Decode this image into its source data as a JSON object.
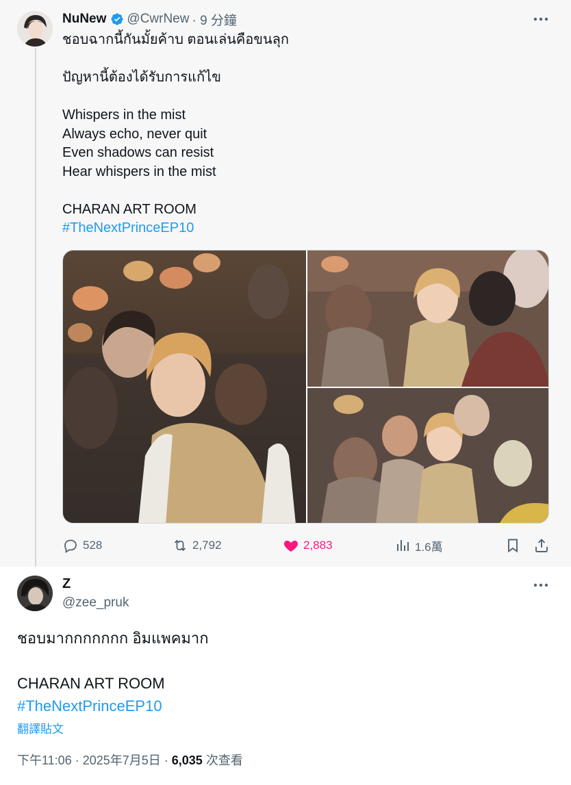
{
  "parent_tweet": {
    "display_name": "NuNew",
    "handle": "@CwrNew",
    "time": "· 9 分鐘",
    "body_lines": [
      "ชอบฉากนี้กันมั้ยค้าบ ตอนเล่นคือขนลุก",
      "",
      "ปัญหานี้ต้องได้รับการแก้ไข",
      "",
      "Whispers in the mist",
      "Always echo, never quit",
      "Even shadows can resist",
      "Hear whispers in the mist",
      "",
      "CHARAN ART ROOM"
    ],
    "hashtag": "#TheNextPrinceEP10",
    "stats": {
      "replies": "528",
      "retweets": "2,792",
      "likes": "2,883",
      "views": "1.6萬"
    },
    "colors": {
      "like": "#f91880",
      "link": "#1d9bf0",
      "verified": "#1d9bf0"
    }
  },
  "main_tweet": {
    "display_name": "Z",
    "handle": "@zee_pruk",
    "body_lines": [
      "ชอบมากกกกกกก อิมแพคมาก",
      "",
      "CHARAN ART ROOM"
    ],
    "hashtag": "#TheNextPrinceEP10",
    "translate_label": "翻譯貼文",
    "timestamp": "下午11:06 · 2025年7月5日 · ",
    "views_count": "6,035",
    "views_label": " 次查看"
  },
  "icons": [
    "verified-badge-icon",
    "more-options-icon",
    "reply-icon",
    "retweet-icon",
    "like-heart-icon",
    "views-chart-icon",
    "bookmark-icon",
    "share-icon"
  ]
}
